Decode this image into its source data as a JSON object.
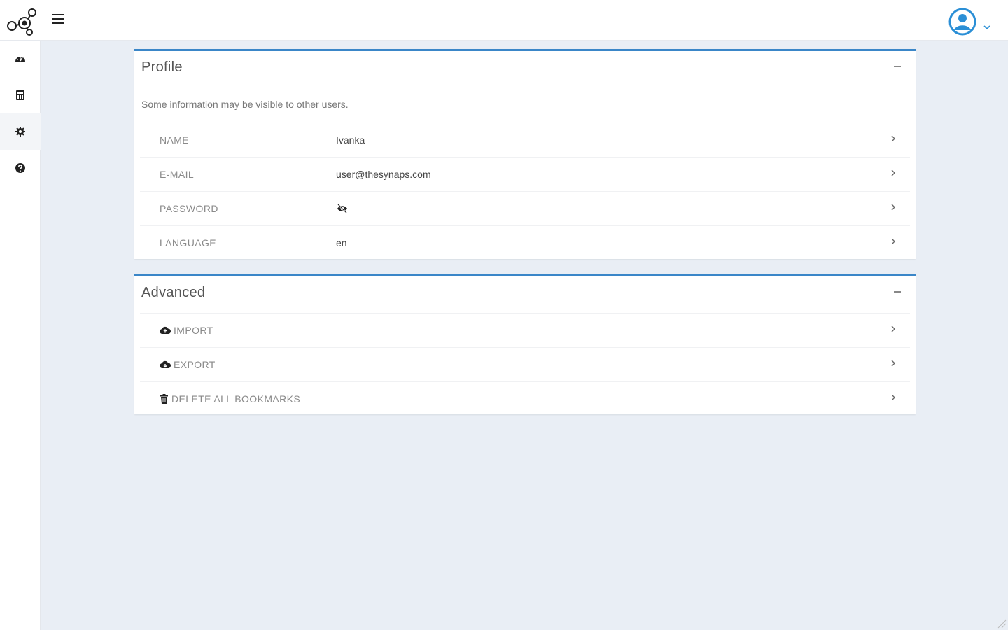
{
  "header": {
    "logo_icon": "synaps-logo-icon",
    "menu_icon": "hamburger-icon",
    "user_icon": "user-circle-icon",
    "user_caret_icon": "chevron-down-icon",
    "accent_color": "#3a86c8"
  },
  "sidebar": {
    "items": [
      {
        "icon": "dashboard-icon",
        "active": false
      },
      {
        "icon": "calculator-icon",
        "active": false
      },
      {
        "icon": "gear-icon",
        "active": true
      },
      {
        "icon": "help-icon",
        "active": false
      }
    ]
  },
  "profile": {
    "title": "Profile",
    "description": "Some information may be visible to other users.",
    "rows": [
      {
        "label": "NAME",
        "value": "Ivanka"
      },
      {
        "label": "E-MAIL",
        "value": "user@thesynaps.com"
      },
      {
        "label": "PASSWORD",
        "value_icon": "eye-slash-icon"
      },
      {
        "label": "LANGUAGE",
        "value": "en"
      }
    ]
  },
  "advanced": {
    "title": "Advanced",
    "rows": [
      {
        "label": "IMPORT",
        "icon": "cloud-upload-icon"
      },
      {
        "label": "EXPORT",
        "icon": "cloud-download-icon"
      },
      {
        "label": "DELETE ALL BOOKMARKS",
        "icon": "trash-icon"
      }
    ]
  }
}
